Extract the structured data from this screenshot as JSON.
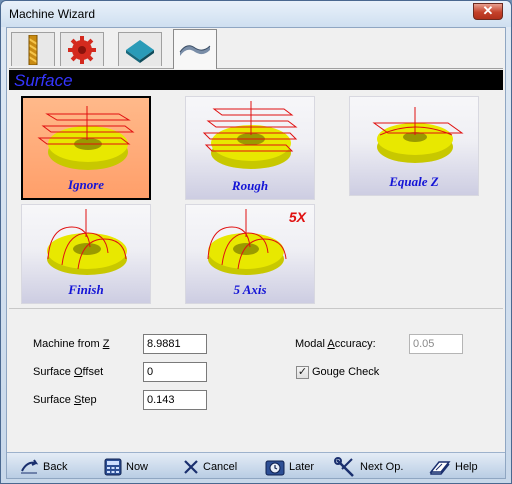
{
  "window": {
    "title": "Machine Wizard",
    "close_glyph": "✕"
  },
  "tabs": [
    {
      "icon": "drill-bit-icon",
      "active": false
    },
    {
      "icon": "gear-icon",
      "active": false
    },
    {
      "icon": "stock-block-icon",
      "active": false
    },
    {
      "icon": "surface-icon",
      "active": true
    }
  ],
  "section": {
    "title": "Surface"
  },
  "options": [
    {
      "label": "Ignore",
      "selected": true
    },
    {
      "label": "Rough",
      "selected": false
    },
    {
      "label": "Equale Z",
      "selected": false
    },
    {
      "label": "Finish",
      "selected": false
    },
    {
      "label": "5 Axis",
      "selected": false,
      "badge": "5X"
    }
  ],
  "fields": {
    "machine_from_z": {
      "label_pre": "Machine from ",
      "label_key": "Z",
      "label_post": "",
      "value": "8.9881"
    },
    "surface_offset": {
      "label_pre": "Surface ",
      "label_key": "O",
      "label_post": "ffset",
      "value": "0"
    },
    "surface_step": {
      "label_pre": "Surface ",
      "label_key": "S",
      "label_post": "tep",
      "value": "0.143"
    },
    "modal_accuracy": {
      "label_pre": "Modal ",
      "label_key": "A",
      "label_post": "ccuracy:",
      "value": "0.05"
    },
    "gouge_check": {
      "label": "Gouge Check",
      "checked": true,
      "check_glyph": "✓"
    }
  },
  "buttons": {
    "back": "Back",
    "now": "Now",
    "cancel": "Cancel",
    "later": "Later",
    "next": "Next Op.",
    "help": "Help"
  },
  "colors": {
    "accent_label": "#1414d6",
    "selected_card": "#ff9f6a",
    "toolpath": "#e01010",
    "part": "#e8e800"
  }
}
